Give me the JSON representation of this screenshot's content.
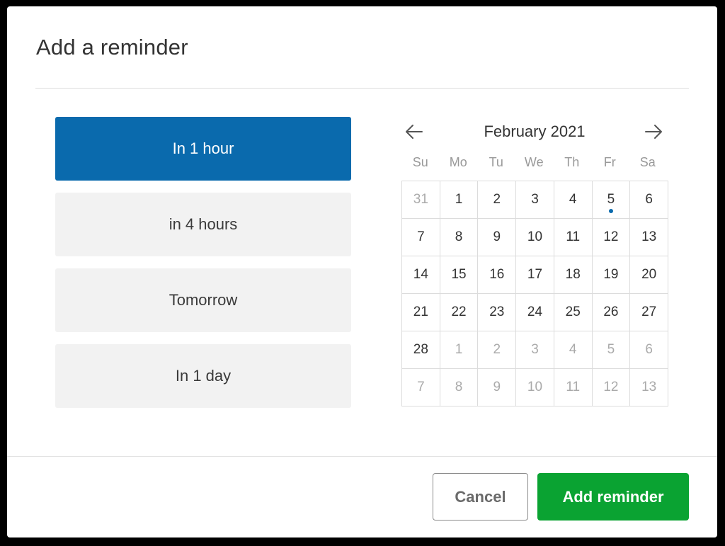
{
  "dialog": {
    "title": "Add a reminder"
  },
  "quick_options": [
    {
      "label": "In 1 hour",
      "selected": true
    },
    {
      "label": "in 4 hours",
      "selected": false
    },
    {
      "label": "Tomorrow",
      "selected": false
    },
    {
      "label": "In 1 day",
      "selected": false
    }
  ],
  "calendar": {
    "month_label": "February 2021",
    "prev_icon": "arrow-left-icon",
    "next_icon": "arrow-right-icon",
    "weekdays": [
      "Su",
      "Mo",
      "Tu",
      "We",
      "Th",
      "Fr",
      "Sa"
    ],
    "marked_day": 5,
    "marker_color": "#0a6aad",
    "days": [
      {
        "label": "31",
        "muted": true
      },
      {
        "label": "1",
        "muted": false
      },
      {
        "label": "2",
        "muted": false
      },
      {
        "label": "3",
        "muted": false
      },
      {
        "label": "4",
        "muted": false
      },
      {
        "label": "5",
        "muted": false,
        "marked": true
      },
      {
        "label": "6",
        "muted": false
      },
      {
        "label": "7",
        "muted": false
      },
      {
        "label": "8",
        "muted": false
      },
      {
        "label": "9",
        "muted": false
      },
      {
        "label": "10",
        "muted": false
      },
      {
        "label": "11",
        "muted": false
      },
      {
        "label": "12",
        "muted": false
      },
      {
        "label": "13",
        "muted": false
      },
      {
        "label": "14",
        "muted": false
      },
      {
        "label": "15",
        "muted": false
      },
      {
        "label": "16",
        "muted": false
      },
      {
        "label": "17",
        "muted": false
      },
      {
        "label": "18",
        "muted": false
      },
      {
        "label": "19",
        "muted": false
      },
      {
        "label": "20",
        "muted": false
      },
      {
        "label": "21",
        "muted": false
      },
      {
        "label": "22",
        "muted": false
      },
      {
        "label": "23",
        "muted": false
      },
      {
        "label": "24",
        "muted": false
      },
      {
        "label": "25",
        "muted": false
      },
      {
        "label": "26",
        "muted": false
      },
      {
        "label": "27",
        "muted": false
      },
      {
        "label": "28",
        "muted": false
      },
      {
        "label": "1",
        "muted": true
      },
      {
        "label": "2",
        "muted": true
      },
      {
        "label": "3",
        "muted": true
      },
      {
        "label": "4",
        "muted": true
      },
      {
        "label": "5",
        "muted": true
      },
      {
        "label": "6",
        "muted": true
      },
      {
        "label": "7",
        "muted": true
      },
      {
        "label": "8",
        "muted": true
      },
      {
        "label": "9",
        "muted": true
      },
      {
        "label": "10",
        "muted": true
      },
      {
        "label": "11",
        "muted": true
      },
      {
        "label": "12",
        "muted": true
      },
      {
        "label": "13",
        "muted": true
      }
    ]
  },
  "footer": {
    "cancel_label": "Cancel",
    "add_label": "Add reminder"
  },
  "colors": {
    "selected_option": "#0a6aad",
    "primary_button": "#0aa332"
  }
}
